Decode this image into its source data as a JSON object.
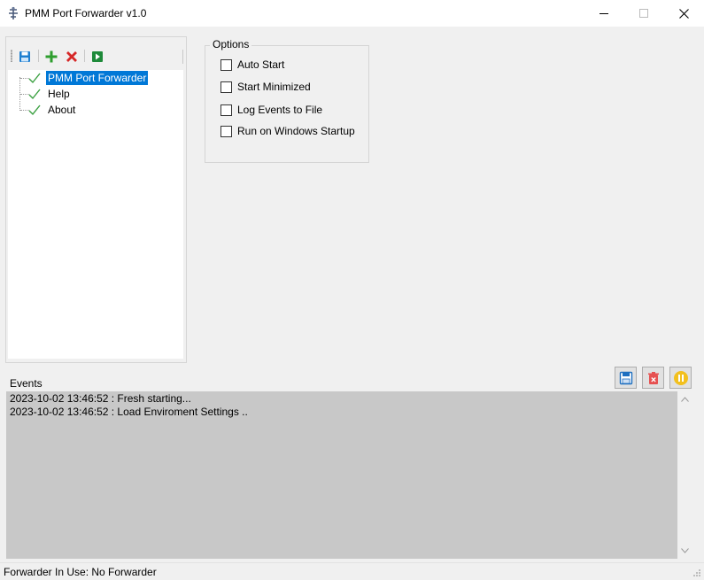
{
  "window": {
    "title": "PMM Port Forwarder v1.0",
    "icon": "app-icon"
  },
  "toolbar": {
    "buttons": [
      {
        "name": "save",
        "icon": "floppy-icon"
      },
      {
        "name": "add",
        "icon": "plus-icon",
        "color": "#2e9e2e"
      },
      {
        "name": "delete",
        "icon": "x-icon",
        "color": "#d62828"
      },
      {
        "name": "start",
        "icon": "play-icon",
        "color": "#1e8a3a"
      }
    ]
  },
  "tree": {
    "items": [
      {
        "label": "PMM Port Forwarder",
        "selected": true
      },
      {
        "label": "Help",
        "selected": false
      },
      {
        "label": "About",
        "selected": false
      }
    ]
  },
  "options": {
    "legend": "Options",
    "items": [
      {
        "label": "Auto Start",
        "checked": false
      },
      {
        "label": "Start Minimized",
        "checked": false
      },
      {
        "label": "Log Events to File",
        "checked": false
      },
      {
        "label": "Run on Windows Startup",
        "checked": false
      }
    ]
  },
  "events": {
    "label": "Events",
    "lines": [
      "2023-10-02 13:46:52 : Fresh starting...",
      "2023-10-02 13:46:52 : Load Enviroment Settings .."
    ]
  },
  "status": {
    "text": "Forwarder In Use: No Forwarder"
  },
  "colors": {
    "selection": "#0078d7",
    "log_background": "#c8c8c8",
    "check_green": "#3aa040"
  }
}
